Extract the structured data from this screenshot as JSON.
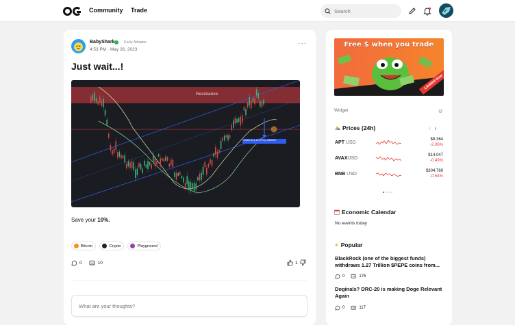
{
  "nav": {
    "logo_text": "OG",
    "links": [
      "Community",
      "Trade"
    ],
    "search_placeholder": "Search"
  },
  "post": {
    "author": "BabyShark",
    "badge": "Early Adopter",
    "time": "4:53 PM · May 26, 2023",
    "title": "Just wait...!",
    "text_prefix": "Save your ",
    "text_bold": "10%.",
    "chart_label": "Resistance",
    "chart_box": "-2665.34 (-10.27%) -266534",
    "tags": [
      {
        "label": "Bitcoin",
        "color": "#f7931a"
      },
      {
        "label": "Crypto",
        "color": "#222222"
      },
      {
        "label": "Playground",
        "color": "#8e44ad"
      }
    ],
    "comments": "0",
    "reposts": "10",
    "likes": "1",
    "comment_placeholder": "What are your thoughts?"
  },
  "sidebar": {
    "banner_title": "Free $ when you trade",
    "banner_ribbon": "Limited time",
    "widget_label": "Widget",
    "prices_title": "Prices (24h)",
    "tickers": [
      {
        "sym": "APT",
        "quote": "USD",
        "price": "$8.364",
        "change": "-2.06%",
        "color": "#e53935"
      },
      {
        "sym": "AVAX",
        "quote": "USD",
        "price": "$14.047",
        "change": "-0.49%",
        "color": "#e53935"
      },
      {
        "sym": "BNB",
        "quote": "USD",
        "price": "$304.769",
        "change": "-0.54%",
        "color": "#e53935"
      }
    ],
    "calendar_title": "Economic Calendar",
    "calendar_empty": "No events today",
    "popular_title": "Popular",
    "popular": [
      {
        "title": "BlackRock (one of the biggest funds) withdraws 1.27 Trillion $PEPE coins from...",
        "comments": "0",
        "views": "176"
      },
      {
        "title": "Doginals? DRC-20 is making Doge Relevant Again",
        "comments": "0",
        "views": "117"
      }
    ]
  }
}
